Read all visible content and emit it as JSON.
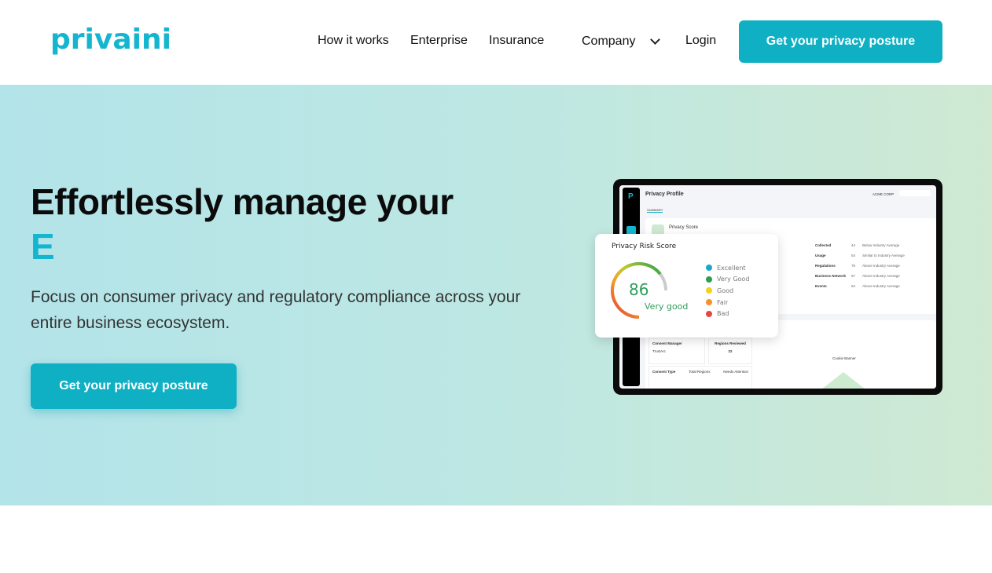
{
  "header": {
    "logo": "privaini",
    "nav": [
      "How it works",
      "Enterprise",
      "Insurance",
      "Company",
      "Login"
    ],
    "cta": "Get your privacy posture"
  },
  "hero": {
    "title": "Effortlessly manage your",
    "typed": "E",
    "subtitle": "Focus on consumer privacy and regulatory compliance across your entire business ecosystem.",
    "cta": "Get your privacy posture"
  },
  "mockup": {
    "logo": "P",
    "title": "Privacy Profile",
    "org": "ACME CORP",
    "tab": "SUMMARY",
    "card_title": "Privacy Score",
    "rows": [
      {
        "label": "Collected",
        "value": "44",
        "comp": "Below Industry Average"
      },
      {
        "label": "Usage",
        "value": "54",
        "comp": "Similar to Industry Average"
      },
      {
        "label": "Regulations",
        "value": "75",
        "comp": "Above Industry Average"
      },
      {
        "label": "Business Network",
        "value": "67",
        "comp": "Above Industry Average"
      },
      {
        "label": "Events",
        "value": "94",
        "comp": "Above Industry Average"
      }
    ],
    "consent_manager": "Consent Manager",
    "consent_manager_value": "TrustArc",
    "regions_reviewed": "Regions Reviewed",
    "regions_reviewed_value": "22",
    "consent_type": "Consent Type",
    "total_regions": "Total Regions",
    "needs_attention": "Needs Attention",
    "cookie_banner": "Cookie Banner"
  },
  "score_card": {
    "title": "Privacy Risk Score",
    "score": "86",
    "rating": "Very good",
    "score_fraction": 0.86,
    "legend": [
      {
        "label": "Excellent",
        "color": "#1aa6d0"
      },
      {
        "label": "Very Good",
        "color": "#2e9d4f"
      },
      {
        "label": "Good",
        "color": "#f1d21c"
      },
      {
        "label": "Fair",
        "color": "#f5922a"
      },
      {
        "label": "Bad",
        "color": "#e84545"
      }
    ]
  },
  "colors": {
    "brand": "#14b6cf",
    "button": "#0fb0c4"
  }
}
